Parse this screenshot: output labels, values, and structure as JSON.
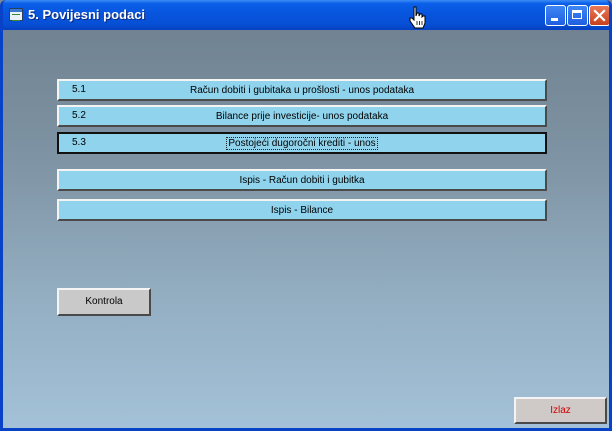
{
  "window": {
    "title": "5. Povijesni podaci"
  },
  "menu_buttons": [
    {
      "number": "5.1",
      "label": "Račun dobiti i gubitaka u prošlosti - unos podataka"
    },
    {
      "number": "5.2",
      "label": "Bilance prije investicije- unos podataka"
    },
    {
      "number": "5.3",
      "label": "Postojeći dugoročni krediti - unos"
    },
    {
      "number": "",
      "label": "Ispis - Račun dobiti i gubitka"
    },
    {
      "number": "",
      "label": "Ispis - Bilance"
    }
  ],
  "actions": {
    "check_label": "Kontrola",
    "exit_label": "Izlaz"
  },
  "colors": {
    "title_bar": "#0854dc",
    "button_face": "#8fd3ed",
    "exit_text": "#d00000"
  },
  "icons": {
    "app": "form-icon",
    "minimize": "minimize-icon",
    "maximize": "maximize-icon",
    "close": "close-icon",
    "cursor": "hand-pointer-icon"
  }
}
